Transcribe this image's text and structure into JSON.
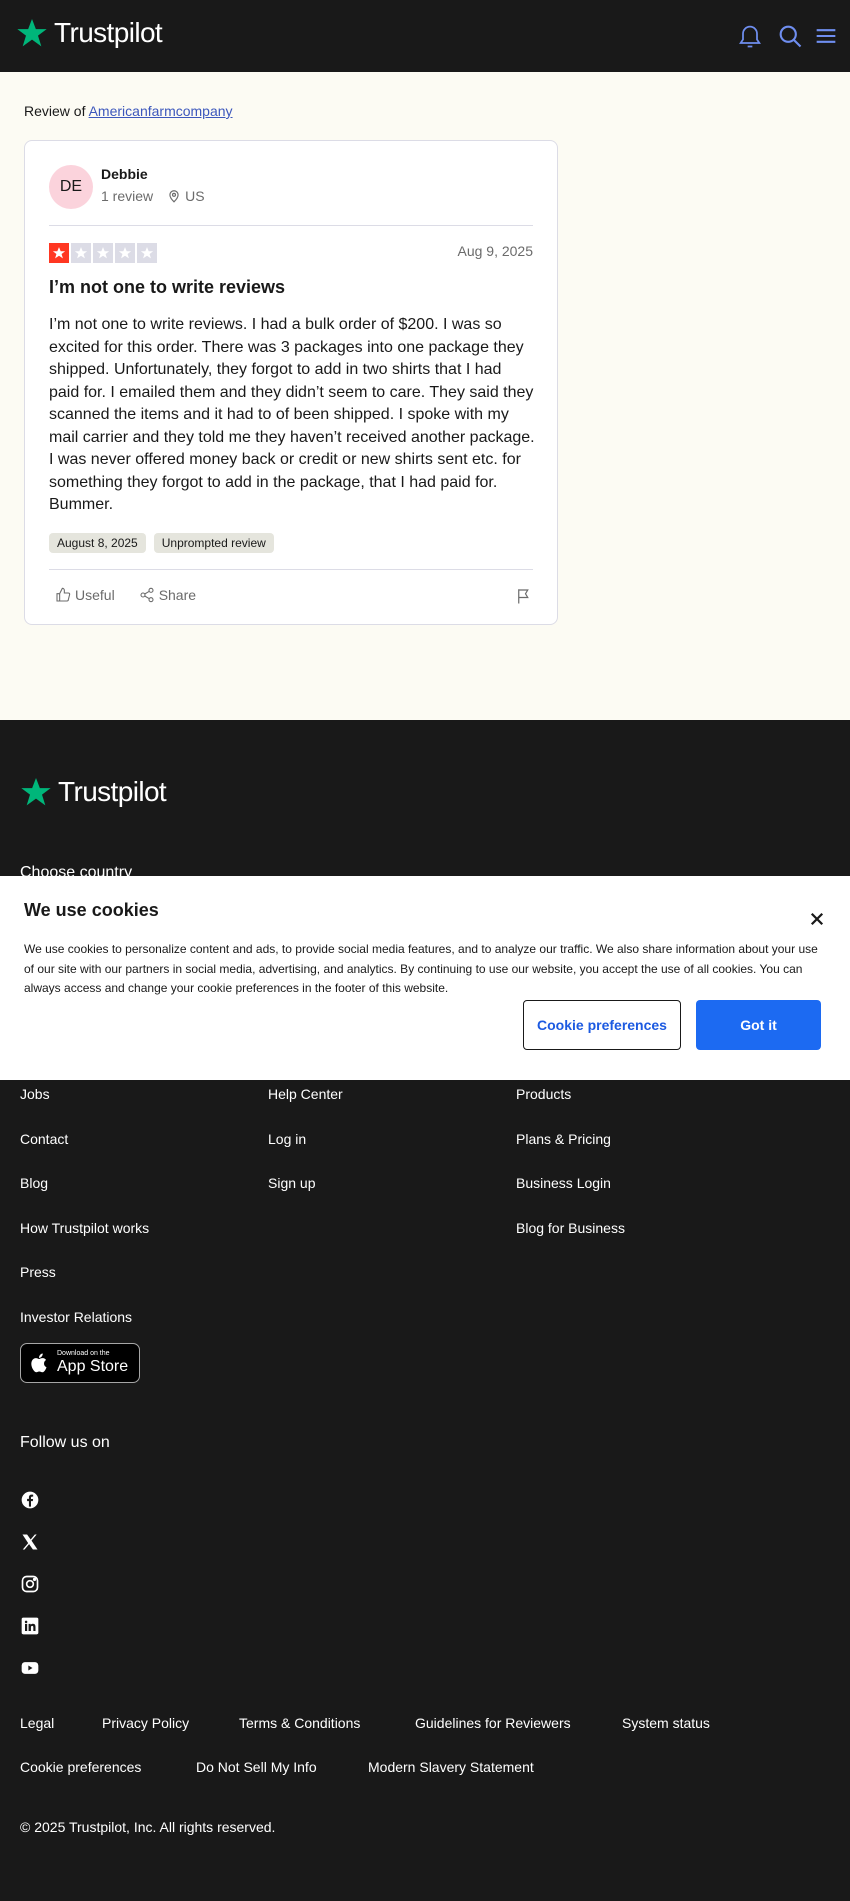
{
  "header": {
    "brand": "Trustpilot",
    "icons": [
      "bell-icon",
      "search-icon",
      "menu-icon"
    ]
  },
  "main": {
    "review_of_label": "Review of",
    "company_name": "Americanfarmcompany",
    "reviewer": {
      "initials": "DE",
      "name": "Debbie",
      "review_count": "1 review",
      "country": "US"
    },
    "review": {
      "rating": 1,
      "date": "Aug 9, 2025",
      "title": "I’m not one to write reviews",
      "body": "I’m not one to write reviews. I had a bulk order of $200. I was so excited for this order. There was 3 packages into one package they shipped. Unfortunately, they forgot to add in two shirts that I had paid for. I emailed them and they didn’t seem to care. They said they scanned the items and it had to of been shipped. I spoke with my mail carrier and they told me they haven’t received another package. I was never offered money back or credit or new shirts sent etc. for something they forgot to add in the package, that I had paid for. Bummer.",
      "experience_date": "August 8, 2025",
      "review_type": "Unprompted review",
      "useful_label": "Useful",
      "share_label": "Share"
    }
  },
  "footer": {
    "brand": "Trustpilot",
    "choose_country": "Choose country",
    "col1": [
      "Jobs",
      "Contact",
      "Blog",
      "How Trustpilot works",
      "Press",
      "Investor Relations"
    ],
    "col2": [
      "Help Center",
      "Log in",
      "Sign up"
    ],
    "col3": [
      "Products",
      "Plans & Pricing",
      "Business Login",
      "Blog for Business"
    ],
    "app_store_small": "Download on the",
    "app_store_big": "App Store",
    "follow_us": "Follow us on",
    "social": [
      "facebook-icon",
      "x-icon",
      "instagram-icon",
      "linkedin-icon",
      "youtube-icon"
    ],
    "legal_row1": [
      "Legal",
      "Privacy Policy",
      "Terms & Conditions",
      "Guidelines for Reviewers",
      "System status"
    ],
    "legal_row2": [
      "Cookie preferences",
      "Do Not Sell My Info",
      "Modern Slavery Statement"
    ],
    "copyright": "© 2025 Trustpilot, Inc. All rights reserved."
  },
  "cookie_banner": {
    "title": "We use cookies",
    "text": "We use cookies to personalize content and ads, to provide social media features, and to analyze our traffic. We also share information about your use of our site with our partners in social media, advertising, and analytics. By continuing to use our website, you accept the use of all cookies. You can always access and change your cookie preferences in the footer of this website.",
    "preferences_button": "Cookie preferences",
    "accept_button": "Got it"
  },
  "colors": {
    "header_bg": "#191919",
    "brand_green": "#00b67a",
    "star_red": "#ff3722",
    "link_blue": "#3c57bc",
    "button_blue": "#1c6af2"
  }
}
